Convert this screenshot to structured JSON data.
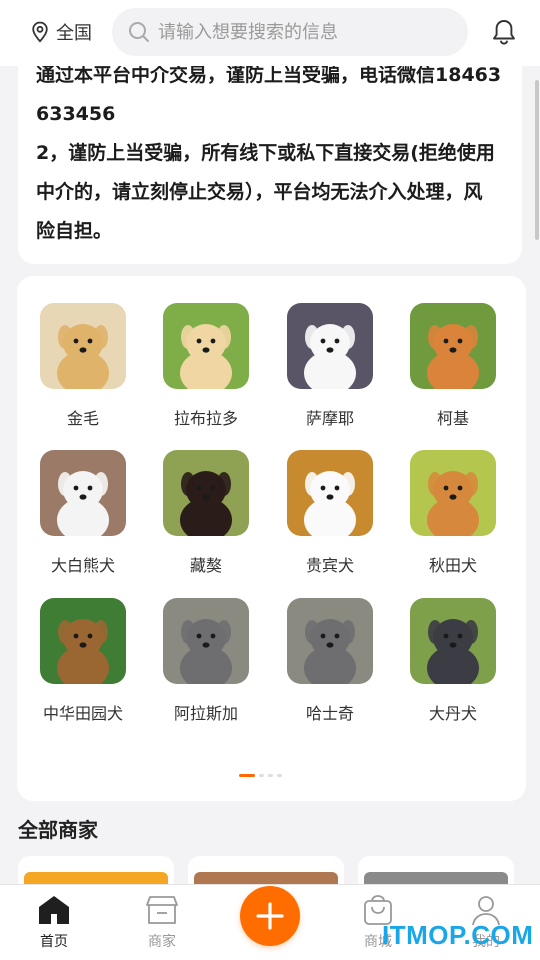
{
  "topbar": {
    "location": "全国",
    "search_placeholder": "请输入想要搜索的信息"
  },
  "notice": {
    "lines": [
      "通过本平台中介交易，谨防上当受骗，电话微信18463",
      "633456",
      "2，谨防上当受骗，所有线下或私下直接交易(拒绝使用",
      "中介的，请立刻停止交易），平台均无法介入处理，风",
      "险自担。"
    ]
  },
  "categories": [
    {
      "name": "金毛",
      "icon": "golden-retriever-photo",
      "bg": "#e8d7b5",
      "fur": "#e0b36a"
    },
    {
      "name": "拉布拉多",
      "icon": "labrador-photo",
      "bg": "#7fae48",
      "fur": "#f0d6a2"
    },
    {
      "name": "萨摩耶",
      "icon": "samoyed-photo",
      "bg": "#5a5566",
      "fur": "#f7f7f7"
    },
    {
      "name": "柯基",
      "icon": "corgi-photo",
      "bg": "#6f9a3d",
      "fur": "#d9843a"
    },
    {
      "name": "大白熊犬",
      "icon": "great-pyrenees-photo",
      "bg": "#9b7b68",
      "fur": "#f4f4f4"
    },
    {
      "name": "藏獒",
      "icon": "tibetan-mastiff-photo",
      "bg": "#8fa253",
      "fur": "#2a1c18"
    },
    {
      "name": "贵宾犬",
      "icon": "poodle-photo",
      "bg": "#c78a2e",
      "fur": "#fafafa"
    },
    {
      "name": "秋田犬",
      "icon": "akita-photo",
      "bg": "#b4c64e",
      "fur": "#d6893c"
    },
    {
      "name": "中华田园犬",
      "icon": "village-dog-photo",
      "bg": "#3f7c34",
      "fur": "#9a6732"
    },
    {
      "name": "阿拉斯加",
      "icon": "alaskan-malamute-photo",
      "bg": "#8a8a80",
      "fur": "#6e6e70"
    },
    {
      "name": "哈士奇",
      "icon": "husky-photo",
      "bg": "#8a8a80",
      "fur": "#6e6e70"
    },
    {
      "name": "大丹犬",
      "icon": "great-dane-photo",
      "bg": "#7fa04a",
      "fur": "#3c3c44"
    }
  ],
  "section": {
    "title": "全部商家"
  },
  "merchants": [
    {
      "name": "merchant-card-1",
      "color": "#f5a623"
    },
    {
      "name": "merchant-card-2",
      "color": "#b07850"
    },
    {
      "name": "merchant-card-3",
      "color": "#8a8a8a"
    }
  ],
  "tabs": [
    {
      "label": "首页",
      "icon": "home-icon",
      "active": true
    },
    {
      "label": "商家",
      "icon": "shop-icon",
      "active": false
    },
    {
      "label": "商城",
      "icon": "shopping-bag-icon",
      "active": false
    },
    {
      "label": "我的",
      "icon": "user-icon",
      "active": false
    }
  ],
  "watermark": "ITMOP.COM",
  "colors": {
    "accent": "#ff6d00",
    "background": "#f3f3f5",
    "watermark": "#1aa7e8"
  }
}
